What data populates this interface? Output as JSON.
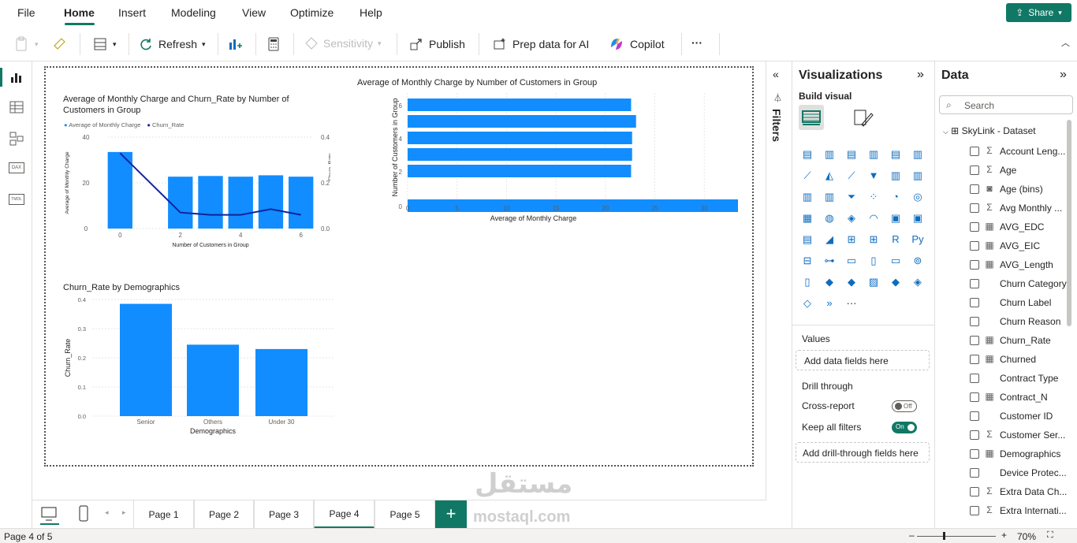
{
  "menu": {
    "items": [
      "File",
      "Home",
      "Insert",
      "Modeling",
      "View",
      "Optimize",
      "Help"
    ],
    "active": "Home",
    "share_label": "Share"
  },
  "toolbar": {
    "refresh": "Refresh",
    "sensitivity": "Sensitivity",
    "publish": "Publish",
    "prep": "Prep data for AI",
    "copilot": "Copilot",
    "more": "···"
  },
  "rail": {
    "dax": "DAX",
    "tmdl": "TMDL"
  },
  "charts": {
    "combo": {
      "title": "Average of Monthly Charge and Churn_Rate by Number of Customers in Group",
      "legend": [
        "Average of Monthly Charge",
        "Churn_Rate"
      ],
      "xlabel": "Number of Customers in Group",
      "ylabel_left": "Average of Monthly Charge",
      "ylabel_right": "Churn_Rate",
      "x_ticks": [
        "0",
        "2",
        "4",
        "6"
      ],
      "y_left_ticks": [
        "40",
        "20",
        "0"
      ],
      "y_right_ticks": [
        "0.4",
        "0.2",
        "0.0"
      ]
    },
    "hbar": {
      "title": "Average of Monthly Charge by Number of Customers in Group",
      "xlabel": "Average of Monthly Charge",
      "ylabel": "Number of Customers in Group",
      "x_ticks": [
        "0",
        "5",
        "10",
        "15",
        "20",
        "25",
        "30",
        "35"
      ],
      "y_ticks": [
        "6",
        "4",
        "2",
        "0"
      ]
    },
    "demo": {
      "title": "Churn_Rate by Demographics",
      "xlabel": "Demographics",
      "ylabel": "Churn_Rate",
      "y_ticks": [
        "0.4",
        "0.3",
        "0.2",
        "0.1",
        "0.0"
      ]
    }
  },
  "chart_data": [
    {
      "type": "bar",
      "title": "Average of Monthly Charge and Churn_Rate by Number of Customers in Group",
      "x": [
        0,
        2,
        3,
        4,
        5,
        6
      ],
      "series": [
        {
          "name": "Average of Monthly Charge",
          "type": "bar",
          "values": [
            33.5,
            22.7,
            23.0,
            22.7,
            23.3,
            22.7
          ]
        },
        {
          "name": "Churn_Rate",
          "type": "line",
          "values": [
            0.33,
            0.07,
            0.06,
            0.06,
            0.085,
            0.06
          ]
        }
      ],
      "xlabel": "Number of Customers in Group",
      "ylabel": "Average of Monthly Charge",
      "ylim": [
        0,
        40
      ],
      "y2lim": [
        0,
        0.4
      ]
    },
    {
      "type": "bar",
      "orientation": "horizontal",
      "title": "Average of Monthly Charge by Number of Customers in Group",
      "categories": [
        6,
        5,
        4,
        3,
        2,
        0
      ],
      "values": [
        22.6,
        23.1,
        22.7,
        22.7,
        22.6,
        33.6
      ],
      "xlabel": "Average of Monthly Charge",
      "ylabel": "Number of Customers in Group",
      "xlim": [
        0,
        35
      ]
    },
    {
      "type": "bar",
      "title": "Churn_Rate by Demographics",
      "categories": [
        "Senior",
        "Others",
        "Under 30"
      ],
      "values": [
        0.385,
        0.245,
        0.23
      ],
      "xlabel": "Demographics",
      "ylabel": "Churn_Rate",
      "ylim": [
        0,
        0.4
      ]
    }
  ],
  "filters_label": "Filters",
  "viz": {
    "title": "Visualizations",
    "build": "Build visual",
    "values": "Values",
    "values_well": "Add data fields here",
    "drill": "Drill through",
    "cross": "Cross-report",
    "cross_state": "Off",
    "keep": "Keep all filters",
    "keep_state": "On",
    "drill_well": "Add drill-through fields here",
    "more": "···"
  },
  "data": {
    "title": "Data",
    "search": "Search",
    "dataset": "SkyLink - Dataset",
    "fields": [
      {
        "name": "Account Leng...",
        "type": "sigma"
      },
      {
        "name": "Age",
        "type": "sigma"
      },
      {
        "name": "Age (bins)",
        "type": "bins"
      },
      {
        "name": "Avg Monthly ...",
        "type": "sigma"
      },
      {
        "name": "AVG_EDC",
        "type": "calc"
      },
      {
        "name": "AVG_EIC",
        "type": "calc"
      },
      {
        "name": "AVG_Length",
        "type": "calc"
      },
      {
        "name": "Churn Category",
        "type": ""
      },
      {
        "name": "Churn Label",
        "type": ""
      },
      {
        "name": "Churn Reason",
        "type": ""
      },
      {
        "name": "Churn_Rate",
        "type": "calc"
      },
      {
        "name": "Churned",
        "type": "calc"
      },
      {
        "name": "Contract Type",
        "type": ""
      },
      {
        "name": "Contract_N",
        "type": "calccol"
      },
      {
        "name": "Customer ID",
        "type": ""
      },
      {
        "name": "Customer Ser...",
        "type": "sigma"
      },
      {
        "name": "Demographics",
        "type": "calccol"
      },
      {
        "name": "Device Protec...",
        "type": ""
      },
      {
        "name": "Extra Data Ch...",
        "type": "sigma"
      },
      {
        "name": "Extra Internati...",
        "type": "sigma"
      }
    ]
  },
  "tabs": [
    "Page 1",
    "Page 2",
    "Page 3",
    "Page 4",
    "Page 5"
  ],
  "active_tab": "Page 4",
  "status": {
    "page": "Page 4 of 5",
    "zoom": "70%"
  },
  "watermark": {
    "arabic": "مستقل",
    "latin": "mostaql.com"
  },
  "colors": {
    "accent": "#117865",
    "bar": "#118DFF",
    "line": "#12239E"
  }
}
